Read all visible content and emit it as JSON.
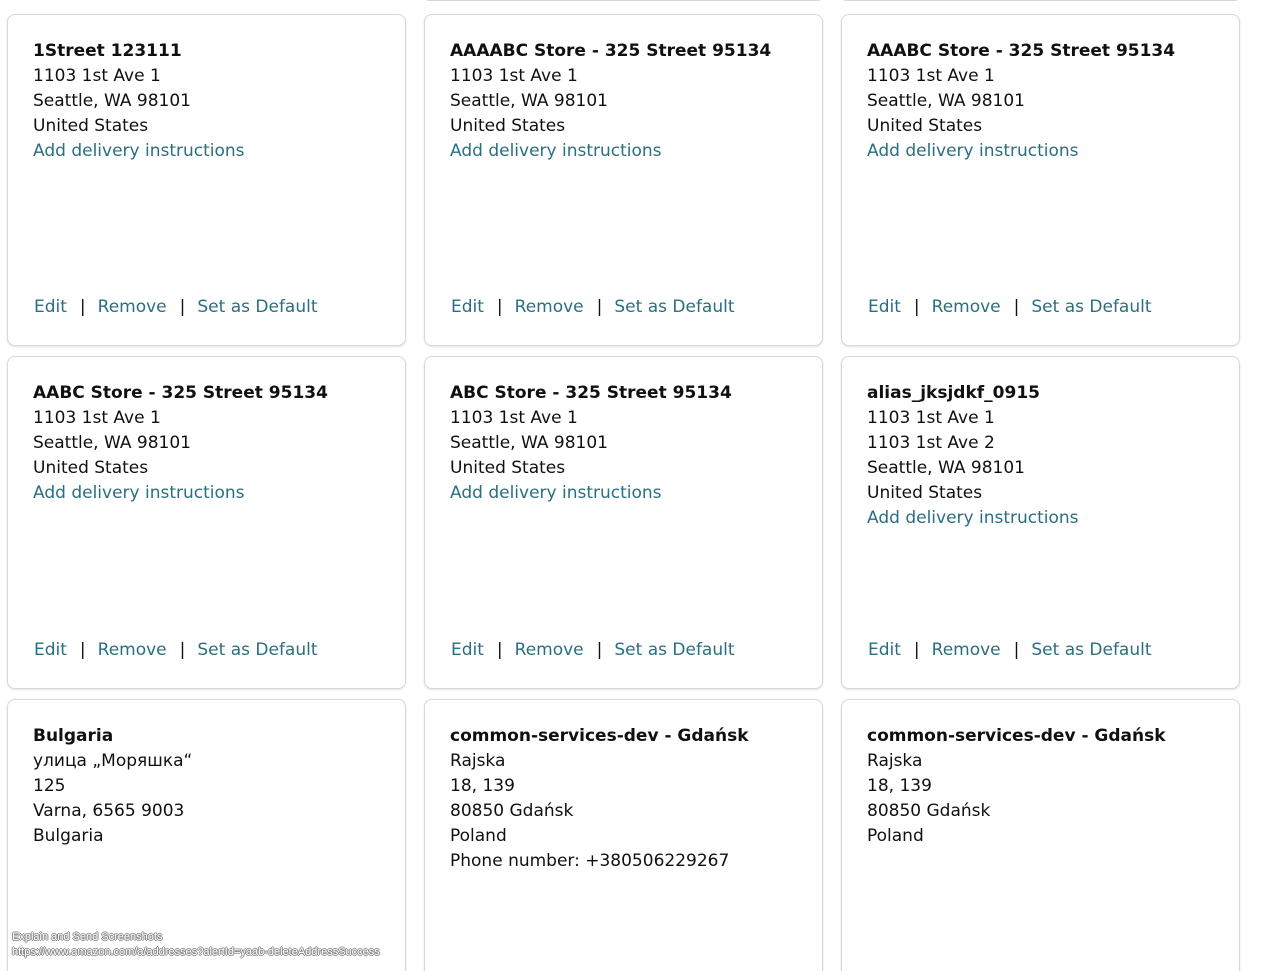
{
  "colors": {
    "link": "#2a6f80",
    "text": "#0f1111",
    "card_border": "#d5d9d9"
  },
  "cards": [
    {
      "name": "1Street 123111",
      "lines": [
        "1103 1st Ave 1",
        "Seattle, WA 98101",
        "United States"
      ],
      "instructions": "Add delivery instructions",
      "actions": {
        "edit": "Edit",
        "remove": "Remove",
        "default": "Set as Default"
      }
    },
    {
      "name": "AAAABC Store - 325 Street 95134",
      "lines": [
        "1103 1st Ave 1",
        "Seattle, WA 98101",
        "United States"
      ],
      "instructions": "Add delivery instructions",
      "actions": {
        "edit": "Edit",
        "remove": "Remove",
        "default": "Set as Default"
      }
    },
    {
      "name": "AAABC Store - 325 Street 95134",
      "lines": [
        "1103 1st Ave 1",
        "Seattle, WA 98101",
        "United States"
      ],
      "instructions": "Add delivery instructions",
      "actions": {
        "edit": "Edit",
        "remove": "Remove",
        "default": "Set as Default"
      }
    },
    {
      "name": "AABC Store - 325 Street 95134",
      "lines": [
        "1103 1st Ave 1",
        "Seattle, WA 98101",
        "United States"
      ],
      "instructions": "Add delivery instructions",
      "actions": {
        "edit": "Edit",
        "remove": "Remove",
        "default": "Set as Default"
      }
    },
    {
      "name": "ABC Store - 325 Street 95134",
      "lines": [
        "1103 1st Ave 1",
        "Seattle, WA 98101",
        "United States"
      ],
      "instructions": "Add delivery instructions",
      "actions": {
        "edit": "Edit",
        "remove": "Remove",
        "default": "Set as Default"
      }
    },
    {
      "name": "alias_jksjdkf_0915",
      "lines": [
        "1103 1st Ave 1",
        "1103 1st Ave 2",
        "Seattle, WA 98101",
        "United States"
      ],
      "instructions": "Add delivery instructions",
      "actions": {
        "edit": "Edit",
        "remove": "Remove",
        "default": "Set as Default"
      }
    },
    {
      "name": "Bulgaria",
      "lines": [
        "улица „Моряшка“",
        "125",
        "Varna, 6565 9003",
        "Bulgaria"
      ]
    },
    {
      "name": "common-services-dev - Gdańsk",
      "lines": [
        "Rajska",
        "18, 139",
        "80850 Gdańsk",
        "Poland",
        "Phone number: +380506229267"
      ]
    },
    {
      "name": "common-services-dev - Gdańsk",
      "lines": [
        "Rajska",
        "18, 139",
        "80850 Gdańsk",
        "Poland"
      ]
    }
  ],
  "status_overlay": {
    "title": "Explain and Send Screenshots",
    "url": "https://www.amazon.com/a/addresses?alertId=yaab-deleteAddressSuccess"
  }
}
